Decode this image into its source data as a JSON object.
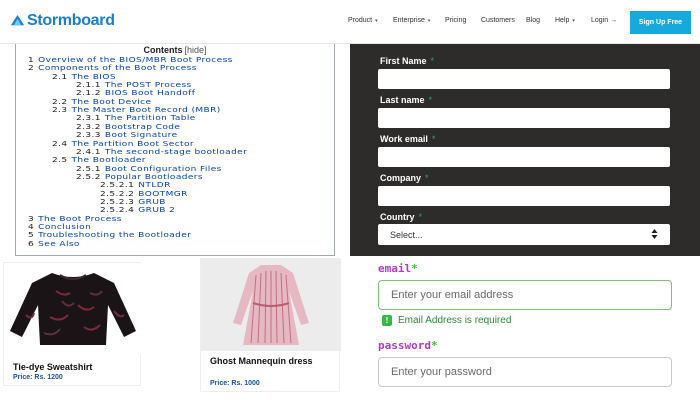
{
  "nav": {
    "brand": "Stormboard",
    "links": [
      {
        "label": "Product",
        "caret": "▾"
      },
      {
        "label": "Enterprise",
        "caret": "▾"
      },
      {
        "label": "Pricing",
        "caret": ""
      },
      {
        "label": "Customers",
        "caret": ""
      },
      {
        "label": "Blog",
        "caret": ""
      },
      {
        "label": "Help",
        "caret": "▾"
      },
      {
        "label": "Login →",
        "caret": ""
      }
    ],
    "signup": "Sign Up Free",
    "brand_color": "#1b7fc6",
    "signup_color": "#16a9dc"
  },
  "toc": {
    "title": "Contents",
    "hide": "[hide]",
    "items": [
      {
        "num": "1",
        "text": "Overview of the BIOS/MBR Boot Process"
      },
      {
        "num": "2",
        "text": "Components of the Boot Process"
      },
      {
        "num": "2.1",
        "text": "The BIOS"
      },
      {
        "num": "2.1.1",
        "text": "The POST Process"
      },
      {
        "num": "2.1.2",
        "text": "BIOS Boot Handoff"
      },
      {
        "num": "2.2",
        "text": "The Boot Device"
      },
      {
        "num": "2.3",
        "text": "The Master Boot Record (MBR)"
      },
      {
        "num": "2.3.1",
        "text": "The Partition Table"
      },
      {
        "num": "2.3.2",
        "text": "Bootstrap Code"
      },
      {
        "num": "2.3.3",
        "text": "Boot Signature"
      },
      {
        "num": "2.4",
        "text": "The Partition Boot Sector"
      },
      {
        "num": "2.4.1",
        "text": "The second-stage bootloader"
      },
      {
        "num": "2.5",
        "text": "The Bootloader"
      },
      {
        "num": "2.5.1",
        "text": "Boot Configuration Files"
      },
      {
        "num": "2.5.2",
        "text": "Popular Bootloaders"
      },
      {
        "num": "2.5.2.1",
        "text": "NTLDR"
      },
      {
        "num": "2.5.2.2",
        "text": "BOOTMGR"
      },
      {
        "num": "2.5.2.3",
        "text": "GRUB"
      },
      {
        "num": "2.5.2.4",
        "text": "GRUB 2"
      },
      {
        "num": "3",
        "text": "The Boot Process"
      },
      {
        "num": "4",
        "text": "Conclusion"
      },
      {
        "num": "5",
        "text": "Troubleshooting the Bootloader"
      },
      {
        "num": "6",
        "text": "See Also"
      }
    ]
  },
  "registration": {
    "fields": [
      {
        "label": "First Name",
        "star": "*"
      },
      {
        "label": "Last name",
        "star": "*"
      },
      {
        "label": "Work email",
        "star": "*"
      },
      {
        "label": "Company",
        "star": "*"
      },
      {
        "label": "Country",
        "star": "*"
      }
    ],
    "country_value": "Select...",
    "panel_color": "#2e2c2a"
  },
  "products": [
    {
      "name": "Tie-dye Sweatshirt",
      "price": "Price: Rs. 1200"
    },
    {
      "name": "Ghost Mannequin dress",
      "price": "Price: Rs. 1000"
    }
  ],
  "login_form": {
    "email_label": "email",
    "email_star": "*",
    "email_placeholder": "Enter your email address",
    "error": "Email Address is required",
    "error_icon": "!",
    "password_label": "password",
    "password_star": "*",
    "password_placeholder": "Enter your password"
  }
}
